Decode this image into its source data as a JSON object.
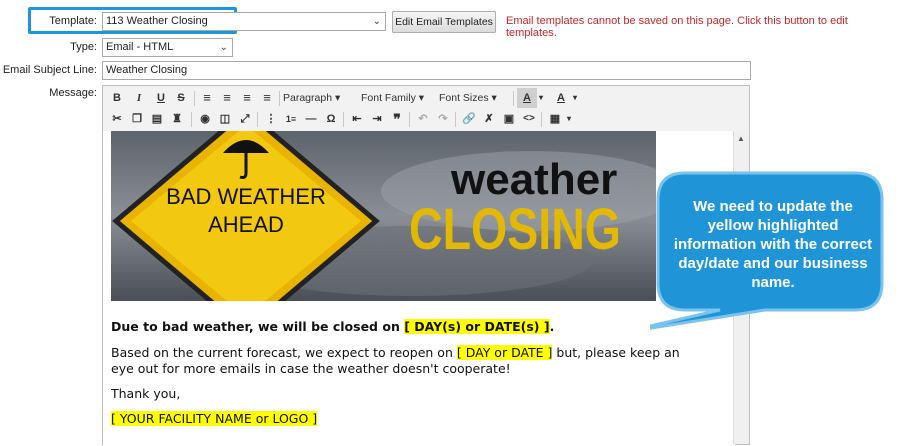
{
  "form": {
    "template_label": "Template:",
    "template_value": "113 Weather Closing",
    "edit_templates_button": "Edit Email Templates",
    "warning": "Email templates cannot be saved on this page. Click this button to edit templates.",
    "type_label": "Type:",
    "type_value": "Email - HTML",
    "subject_label": "Email Subject Line:",
    "subject_value": "Weather Closing",
    "message_label": "Message:"
  },
  "toolbar": {
    "bold": "B",
    "italic": "I",
    "underline": "U",
    "strike": "S",
    "paragraph": "Paragraph",
    "font_family": "Font Family",
    "font_sizes": "Font Sizes",
    "text_color": "A",
    "bg_color": "A"
  },
  "banner": {
    "sign_line1": "BAD WEATHER",
    "sign_line2": "AHEAD",
    "title1": "weather",
    "title2": "CLOSING"
  },
  "message": {
    "line1_prefix": "Due to bad weather, we will be closed on ",
    "line1_highlight": "[ DAY(s) or DATE(s) ]",
    "line1_suffix": ".",
    "line2_prefix": "Based on the current forecast, we expect to reopen on ",
    "line2_highlight": "[ DAY or DATE ]",
    "line2_suffix": " but, please keep an",
    "line3": "eye out for more emails in case the weather doesn't cooperate!",
    "thanks": "Thank you,",
    "facility": "[ YOUR FACILITY NAME or LOGO ]"
  },
  "callout": {
    "text": "We need to update the yellow highlighted information with the correct day/date and our business name."
  },
  "colors": {
    "highlight_box": "#1f95d8",
    "warning": "#c0272d",
    "highlight": "#ffff00",
    "callout_fill": "#1f95d8"
  }
}
